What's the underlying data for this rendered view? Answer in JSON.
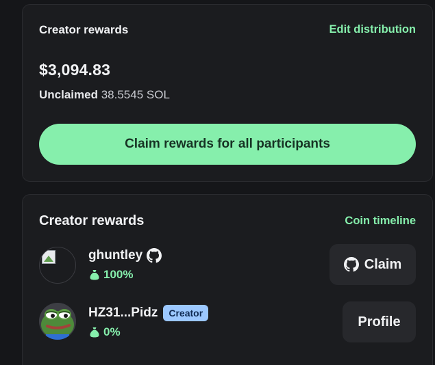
{
  "summary_card": {
    "title": "Creator rewards",
    "edit_link": "Edit distribution",
    "amount": "$3,094.83",
    "unclaimed_label": "Unclaimed",
    "unclaimed_value": "38.5545 SOL",
    "claim_all_label": "Claim rewards for all participants"
  },
  "participants_card": {
    "title": "Creator rewards",
    "timeline_link": "Coin timeline",
    "participants": [
      {
        "name": "ghuntley",
        "share": "100%",
        "has_github_icon": true,
        "action_label": "Claim",
        "action_icon": "github-icon"
      },
      {
        "name": "HZ31...Pidz",
        "badge": "Creator",
        "share": "0%",
        "action_label": "Profile"
      }
    ]
  },
  "colors": {
    "background": "#151619",
    "card": "#1b1c1f",
    "accent_green": "#86efac",
    "badge_blue": "#9cc8ff",
    "button_dark": "#27282c"
  }
}
